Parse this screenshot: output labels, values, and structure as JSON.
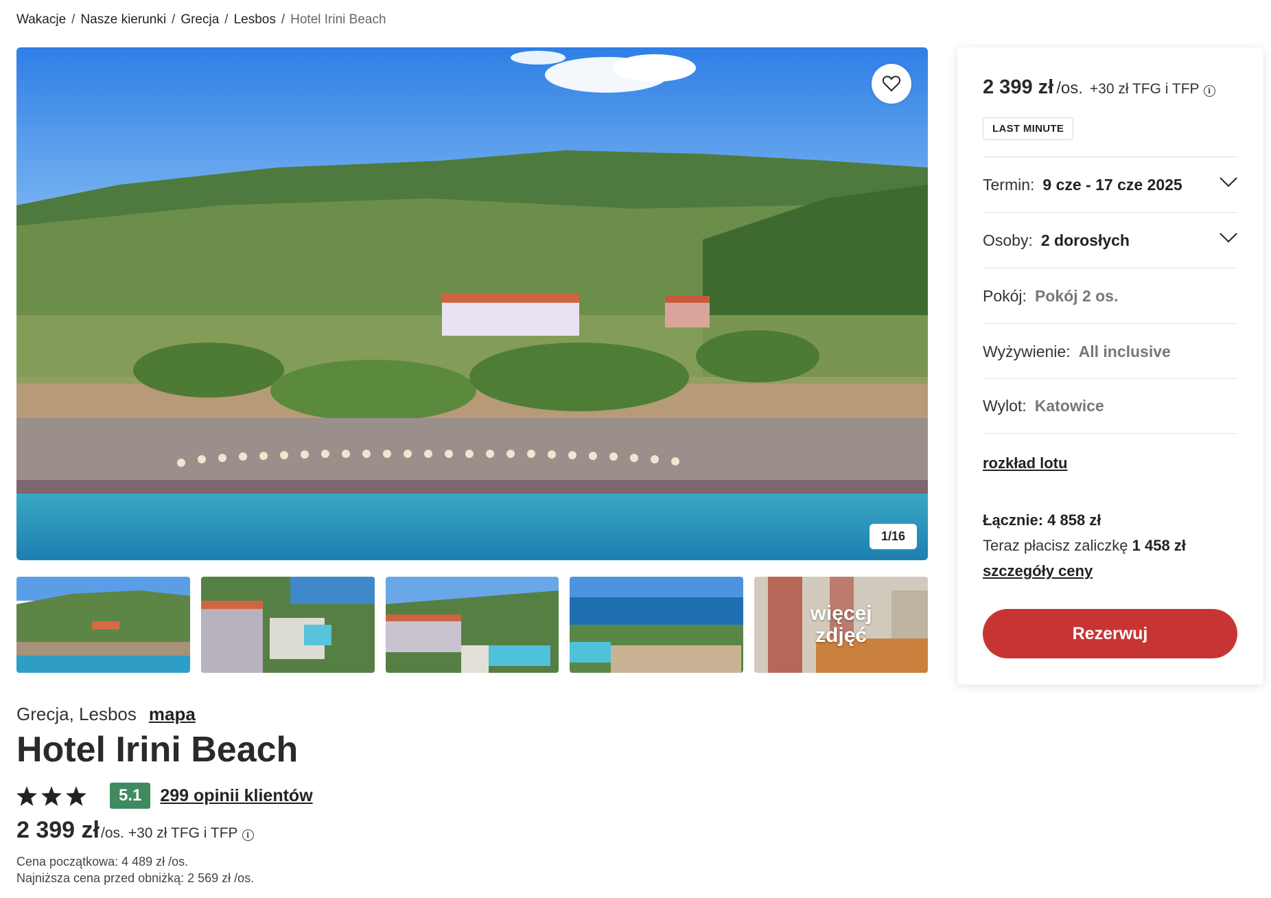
{
  "breadcrumb": {
    "items": [
      "Wakacje",
      "Nasze kierunki",
      "Grecja",
      "Lesbos"
    ],
    "current": "Hotel Irini Beach",
    "separator": "/"
  },
  "gallery": {
    "counter": "1/16",
    "more_photos_line1": "więcej",
    "more_photos_line2": "zdjęć",
    "favorite_icon": "heart-icon"
  },
  "hotel": {
    "location": "Grecja, Lesbos",
    "map_link": "mapa",
    "name": "Hotel Irini Beach",
    "stars": 3,
    "score": "5.1",
    "reviews": "299 opinii klientów",
    "price": "2 399 zł",
    "per_person": "/os.",
    "extra_fee": "+30 zł TFG i TFP",
    "initial_price": "Cena początkowa: 4 489 zł /os.",
    "lowest_price": "Najniższa cena przed obniżką: 2 569 zł /os."
  },
  "booking": {
    "price": "2 399 zł",
    "per_person": "/os.",
    "extra_fee": "+30 zł TFG i TFP",
    "badge": "LAST MINUTE",
    "term_label": "Termin:",
    "term_value": "9 cze - 17 cze 2025",
    "persons_label": "Osoby:",
    "persons_value": "2 dorosłych",
    "room_label": "Pokój:",
    "room_value": "Pokój 2 os.",
    "board_label": "Wyżywienie:",
    "board_value": "All inclusive",
    "departure_label": "Wylot:",
    "departure_value": "Katowice",
    "flight_schedule_link": "rozkład lotu",
    "total": "Łącznie: 4 858 zł",
    "deposit_text": "Teraz płacisz zaliczkę",
    "deposit_amount": "1 458 zł",
    "price_details_link": "szczegóły ceny",
    "book_button": "Rezerwuj"
  },
  "colors": {
    "accent": "#c63534",
    "score_badge": "#3f8a5e"
  }
}
